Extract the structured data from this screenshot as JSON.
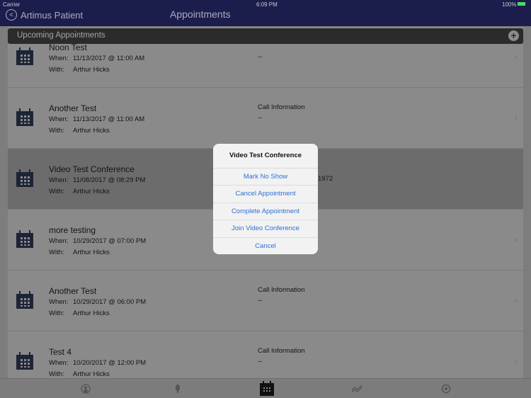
{
  "status_bar": {
    "carrier": "Carrier",
    "time": "6:09 PM",
    "battery": "100%"
  },
  "nav": {
    "back_label": "Artimus Patient",
    "title": "Appointments"
  },
  "section": {
    "title": "Upcoming Appointments"
  },
  "labels": {
    "when": "When:",
    "with": "With:",
    "call_info": "Call Information"
  },
  "appointments": [
    {
      "title": "Noon Test",
      "when": "11/13/2017 @ 11:00 AM",
      "with": "Arthur Hicks",
      "call_info_value": "--",
      "show_call_label": false
    },
    {
      "title": "Another Test",
      "when": "11/13/2017 @ 11:00 AM",
      "with": "Arthur Hicks",
      "call_info_value": "--",
      "show_call_label": true
    },
    {
      "title": "Video Test Conference",
      "when": "11/08/2017 @ 08:29 PM",
      "with": "Arthur Hicks",
      "call_info_value": "1972",
      "selected": true
    },
    {
      "title": "more testing",
      "when": "10/29/2017 @ 07:00 PM",
      "with": "Arthur Hicks"
    },
    {
      "title": "Another Test",
      "when": "10/29/2017 @ 06:00 PM",
      "with": "Arthur Hicks",
      "call_info_value": "--",
      "show_call_label": true
    },
    {
      "title": "Test 4",
      "when": "10/20/2017 @ 12:00 PM",
      "with": "Arthur Hicks",
      "call_info_value": "--",
      "show_call_label": true
    }
  ],
  "alert": {
    "title": "Video Test Conference",
    "actions": [
      "Mark No Show",
      "Cancel Appointment",
      "Complete Appointment",
      "Join Video Conference",
      "Cancel"
    ]
  },
  "tabs": [
    "profile-icon",
    "microphone-icon",
    "calendar-icon",
    "chart-icon",
    "settings-icon"
  ],
  "colors": {
    "nav": "#1b1e4d",
    "action": "#2f6fd6"
  }
}
